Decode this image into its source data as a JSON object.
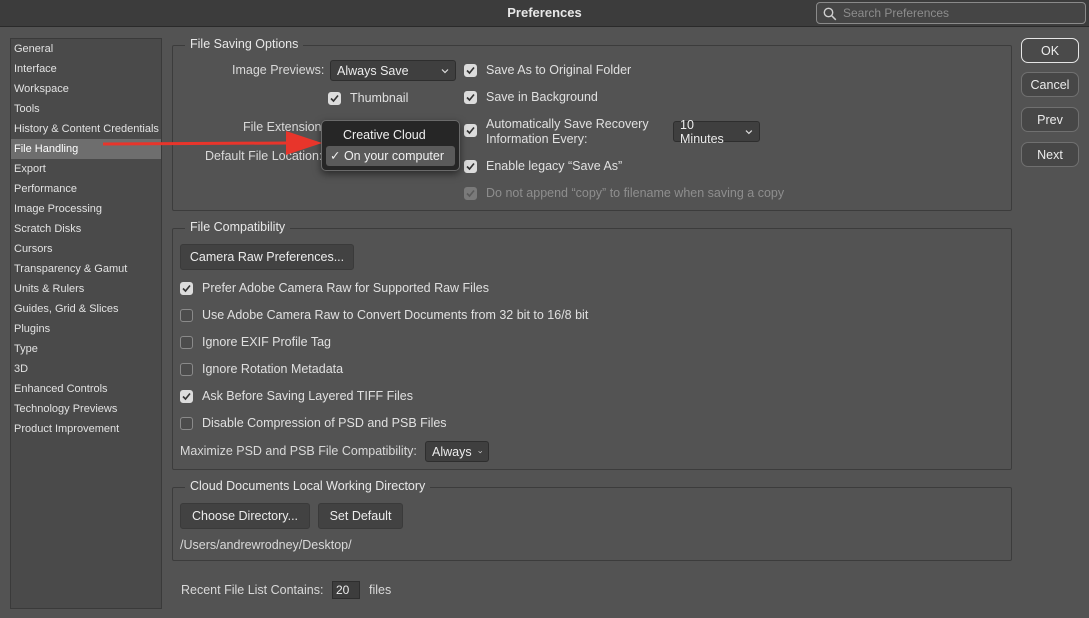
{
  "window": {
    "title": "Preferences"
  },
  "search": {
    "placeholder": "Search Preferences"
  },
  "sidebar": {
    "items": [
      {
        "label": "General"
      },
      {
        "label": "Interface"
      },
      {
        "label": "Workspace"
      },
      {
        "label": "Tools"
      },
      {
        "label": "History & Content Credentials"
      },
      {
        "label": "File Handling",
        "selected": true
      },
      {
        "label": "Export"
      },
      {
        "label": "Performance"
      },
      {
        "label": "Image Processing"
      },
      {
        "label": "Scratch Disks"
      },
      {
        "label": "Cursors"
      },
      {
        "label": "Transparency & Gamut"
      },
      {
        "label": "Units & Rulers"
      },
      {
        "label": "Guides, Grid & Slices"
      },
      {
        "label": "Plugins"
      },
      {
        "label": "Type"
      },
      {
        "label": "3D"
      },
      {
        "label": "Enhanced Controls"
      },
      {
        "label": "Technology Previews"
      },
      {
        "label": "Product Improvement"
      }
    ]
  },
  "buttons": {
    "ok": "OK",
    "cancel": "Cancel",
    "prev": "Prev",
    "next": "Next"
  },
  "file_saving": {
    "title": "File Saving Options",
    "image_previews_label": "Image Previews:",
    "image_previews_value": "Always Save",
    "thumbnail": {
      "label": "Thumbnail",
      "checked": true
    },
    "file_extension_label": "File Extension:",
    "default_location_label": "Default File Location:",
    "location_menu": {
      "options": [
        {
          "label": "Creative Cloud"
        },
        {
          "label": "✓ On your computer",
          "selected": true
        }
      ]
    },
    "save_as_original": {
      "label": "Save As to Original Folder",
      "checked": true
    },
    "save_background": {
      "label": "Save in Background",
      "checked": true
    },
    "auto_save_line1": "Automatically Save Recovery",
    "auto_save_line2": "Information Every:",
    "auto_save_checked": true,
    "auto_save_interval": "10 Minutes",
    "legacy_save_as": {
      "label": "Enable legacy “Save As”",
      "checked": true
    },
    "no_append_copy": {
      "label": "Do not append “copy” to filename when saving a copy",
      "checked": true,
      "disabled": true
    }
  },
  "file_compat": {
    "title": "File Compatibility",
    "camera_raw_button": "Camera Raw Preferences...",
    "options": [
      {
        "label": "Prefer Adobe Camera Raw for Supported Raw Files",
        "checked": true
      },
      {
        "label": "Use Adobe Camera Raw to Convert Documents from 32 bit to 16/8 bit",
        "checked": false
      },
      {
        "label": "Ignore EXIF Profile Tag",
        "checked": false
      },
      {
        "label": "Ignore Rotation Metadata",
        "checked": false
      },
      {
        "label": "Ask Before Saving Layered TIFF Files",
        "checked": true
      },
      {
        "label": "Disable Compression of PSD and PSB Files",
        "checked": false
      }
    ],
    "maximize_label": "Maximize PSD and PSB File Compatibility:",
    "maximize_value": "Always"
  },
  "cloud_docs": {
    "title": "Cloud Documents Local Working Directory",
    "choose_button": "Choose Directory...",
    "default_button": "Set Default",
    "path": "/Users/andrewrodney/Desktop/"
  },
  "recent": {
    "label": "Recent File List Contains:",
    "value": "20",
    "suffix": "files"
  },
  "colors": {
    "annotation_arrow": "#e8352b"
  }
}
